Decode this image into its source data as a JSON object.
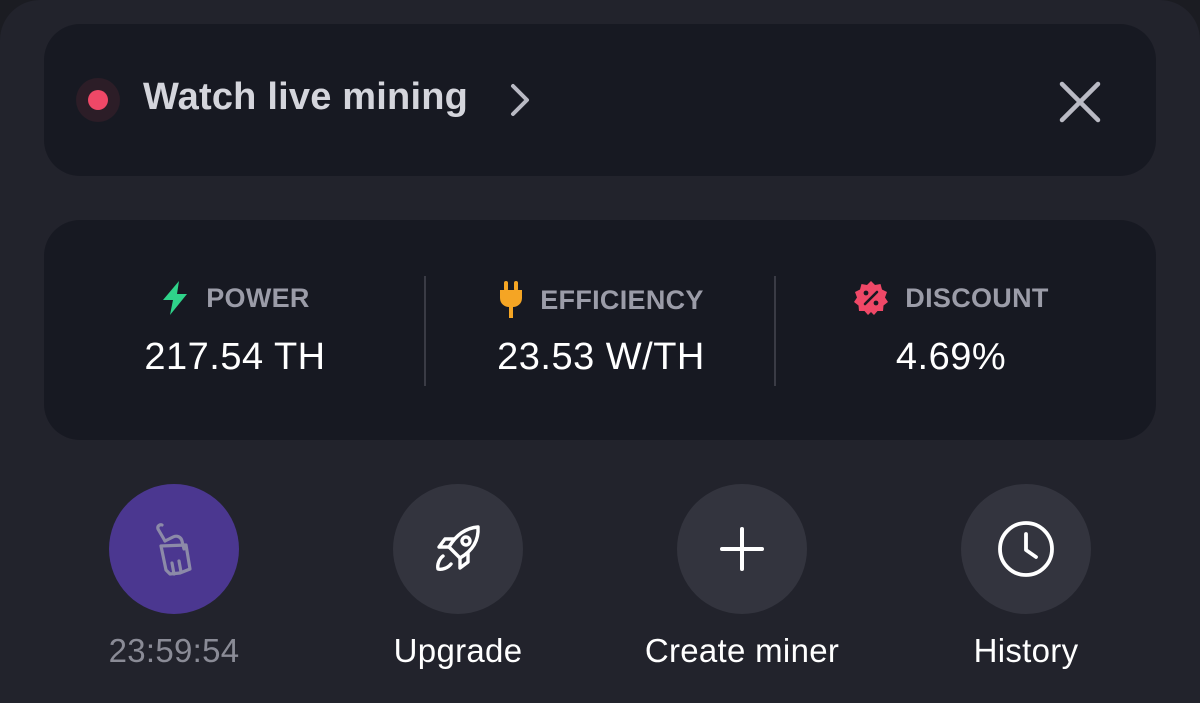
{
  "banner": {
    "label": "Watch live mining",
    "live_color": "#ef4867"
  },
  "stats": [
    {
      "label": "POWER",
      "value": "217.54 TH",
      "icon": "lightning-icon",
      "color": "#2fd38a"
    },
    {
      "label": "EFFICIENCY",
      "value": "23.53 W/TH",
      "icon": "plug-icon",
      "color": "#f5a524"
    },
    {
      "label": "DISCOUNT",
      "value": "4.69%",
      "icon": "discount-badge-icon",
      "color": "#ef4867"
    }
  ],
  "actions": [
    {
      "label": "23:59:54",
      "icon": "broom-icon",
      "accent": "#4b3790"
    },
    {
      "label": "Upgrade",
      "icon": "rocket-icon"
    },
    {
      "label": "Create miner",
      "icon": "plus-icon"
    },
    {
      "label": "History",
      "icon": "clock-icon"
    }
  ]
}
